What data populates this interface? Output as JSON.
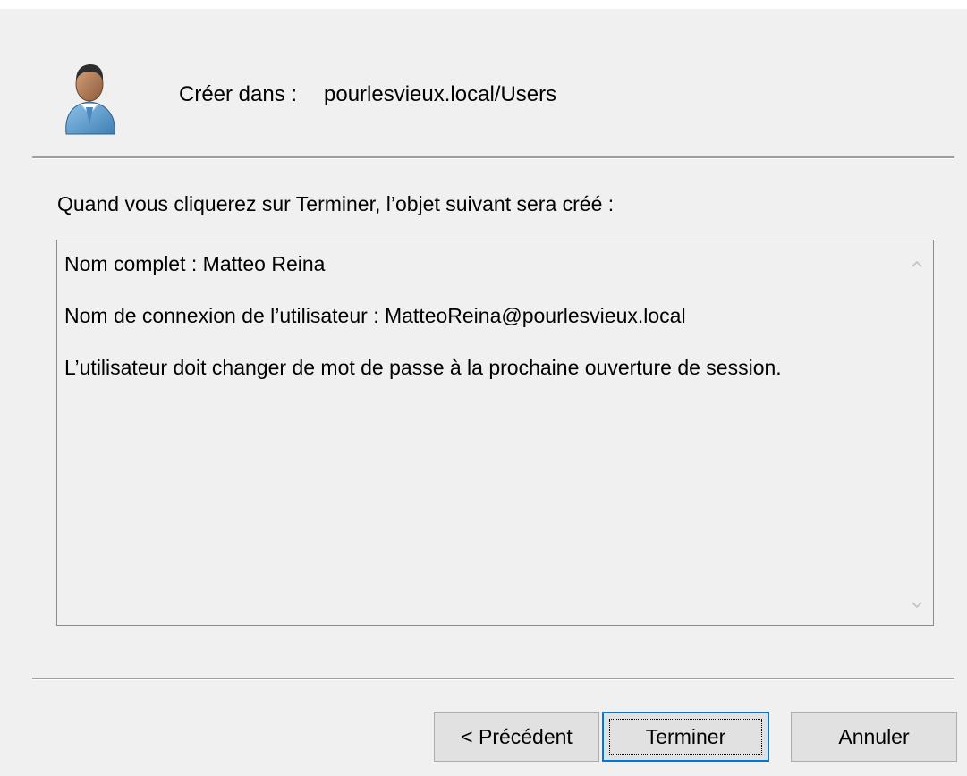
{
  "header": {
    "create_label": "Créer dans :",
    "create_path": "pourlesvieux.local/Users",
    "icon": "user-icon"
  },
  "body": {
    "intro": "Quand vous cliquerez sur Terminer, l’objet suivant sera créé :",
    "summary_lines": [
      "Nom complet : Matteo Reina",
      "Nom de connexion de l’utilisateur : MatteoReina@pourlesvieux.local",
      "L’utilisateur doit changer de mot de passe à la prochaine ouverture de session."
    ]
  },
  "buttons": {
    "previous": "< Précédent",
    "finish": "Terminer",
    "cancel": "Annuler"
  },
  "colors": {
    "dialog_background": "#f0f0f0",
    "focus_border": "#0078d7",
    "button_face": "#e1e1e1"
  }
}
